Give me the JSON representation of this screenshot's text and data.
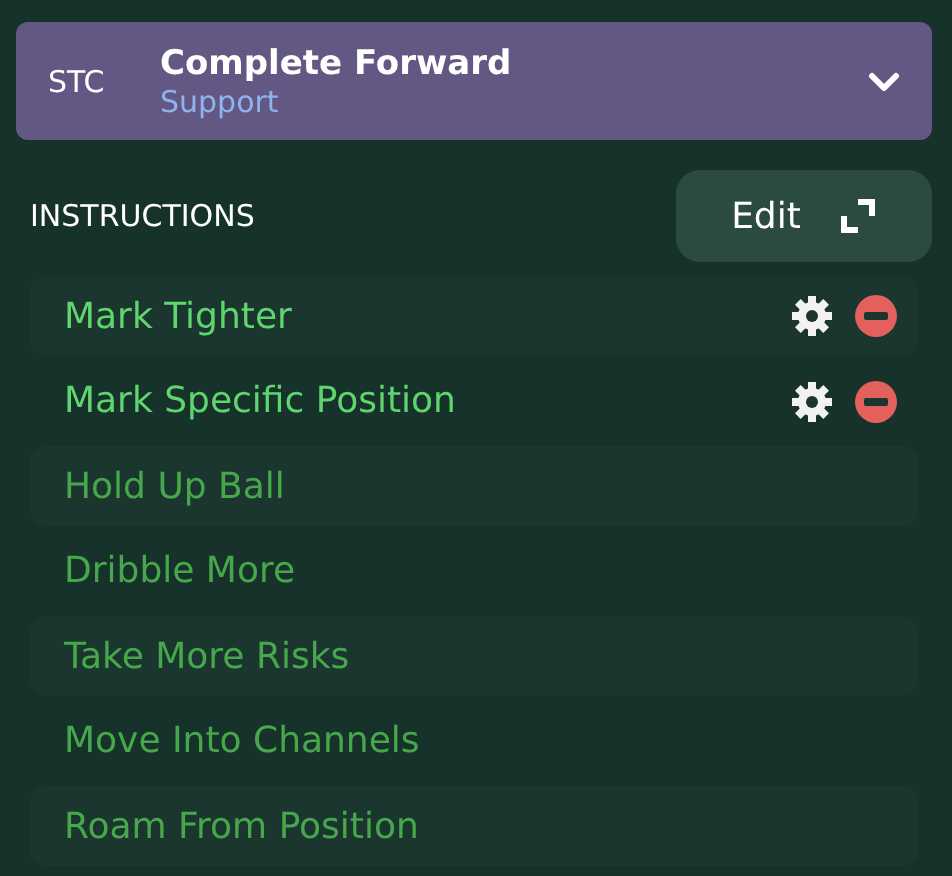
{
  "role": {
    "position": "STC",
    "name": "Complete Forward",
    "duty": "Support"
  },
  "instructions": {
    "title": "INSTRUCTIONS",
    "edit_label": "Edit",
    "items": [
      {
        "label": "Mark Tighter",
        "active": true
      },
      {
        "label": "Mark Specific Position",
        "active": true
      },
      {
        "label": "Hold Up Ball",
        "active": false
      },
      {
        "label": "Dribble More",
        "active": false
      },
      {
        "label": "Take More Risks",
        "active": false
      },
      {
        "label": "Move Into Channels",
        "active": false
      },
      {
        "label": "Roam From Position",
        "active": false
      }
    ]
  }
}
